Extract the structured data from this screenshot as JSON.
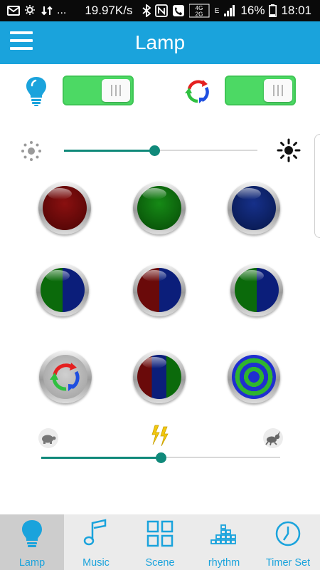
{
  "status_bar": {
    "network_speed": "19.97K/s",
    "network_type_1": "4G",
    "network_type_2": "2G",
    "edge": "E",
    "battery": "16%",
    "time": "18:01"
  },
  "app_bar": {
    "title": "Lamp"
  },
  "toggles": {
    "light_power": true,
    "color_cycle": true
  },
  "brightness": {
    "level_fraction": 0.47
  },
  "color_buttons": [
    {
      "name": "red",
      "colors": [
        "#6a0a0a"
      ]
    },
    {
      "name": "green",
      "colors": [
        "#0b6a0b"
      ]
    },
    {
      "name": "blue",
      "colors": [
        "#0b1e6a"
      ]
    },
    {
      "name": "green-blue",
      "colors": [
        "#0b6a0b",
        "#0b1e7a"
      ]
    },
    {
      "name": "red-blue",
      "colors": [
        "#6a0a0a",
        "#0b1e7a"
      ]
    },
    {
      "name": "green-blue-2",
      "colors": [
        "#0b6a0b",
        "#0b1e7a"
      ]
    },
    {
      "name": "cycle",
      "colors": []
    },
    {
      "name": "red-blue-green",
      "colors": [
        "#6a0a0a",
        "#0b1e7a",
        "#0b6a0b"
      ]
    },
    {
      "name": "concentric",
      "colors": [
        "#1f2fd0",
        "#2fb52f",
        "#2fb52f"
      ]
    }
  ],
  "speed": {
    "level_fraction": 0.5
  },
  "bottom_nav": [
    {
      "label": "Lamp",
      "icon": "bulb-icon",
      "active": true
    },
    {
      "label": "Music",
      "icon": "music-note-icon",
      "active": false
    },
    {
      "label": "Scene",
      "icon": "grid-icon",
      "active": false
    },
    {
      "label": "rhythm",
      "icon": "equalizer-icon",
      "active": false
    },
    {
      "label": "Timer Set",
      "icon": "clock-icon",
      "active": false
    }
  ],
  "colors": {
    "accent": "#1aa3dc",
    "switch_on": "#4cd964",
    "slider": "#10897a"
  }
}
